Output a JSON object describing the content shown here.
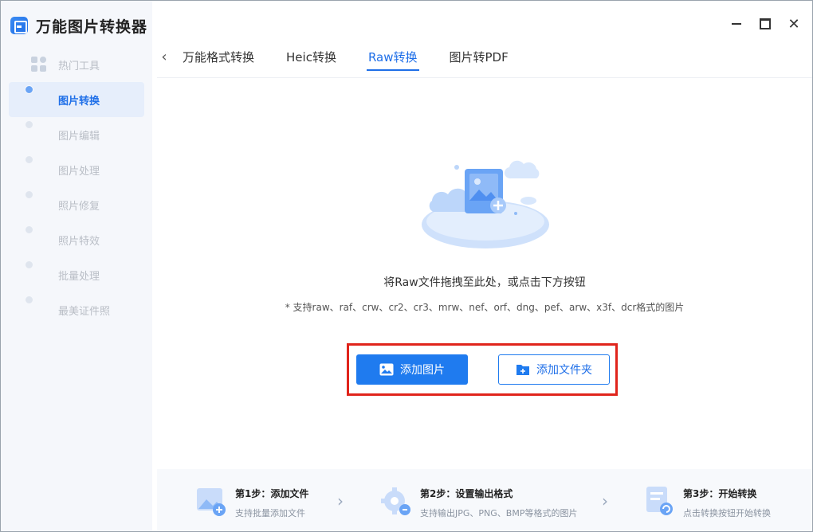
{
  "app": {
    "title": "万能图片转换器"
  },
  "window_controls": {
    "close": "✕"
  },
  "sidebar": {
    "items": [
      {
        "label": "热门工具",
        "icon": "grid-icon",
        "active": false
      },
      {
        "label": "图片转换",
        "icon": "image-convert-icon",
        "active": true
      },
      {
        "label": "图片编辑",
        "icon": "image-edit-icon",
        "active": false
      },
      {
        "label": "图片处理",
        "icon": "image-process-icon",
        "active": false
      },
      {
        "label": "照片修复",
        "icon": "photo-repair-icon",
        "active": false
      },
      {
        "label": "照片特效",
        "icon": "photo-effect-icon",
        "active": false
      },
      {
        "label": "批量处理",
        "icon": "batch-icon",
        "active": false
      },
      {
        "label": "最美证件照",
        "icon": "id-photo-icon",
        "active": false
      }
    ]
  },
  "tabs": {
    "back": "‹",
    "items": [
      {
        "label": "万能格式转换",
        "active": false
      },
      {
        "label": "Heic转换",
        "active": false
      },
      {
        "label": "Raw转换",
        "active": true
      },
      {
        "label": "图片转PDF",
        "active": false
      }
    ]
  },
  "drop": {
    "title": "将Raw文件拖拽至此处，或点击下方按钮",
    "hint": "* 支持raw、raf、crw、cr2、cr3、mrw、nef、orf、dng、pef、arw、x3f、dcr格式的图片",
    "add_image": "添加图片",
    "add_folder": "添加文件夹"
  },
  "steps": [
    {
      "title": "第1步：添加文件",
      "desc": "支持批量添加文件"
    },
    {
      "title": "第2步：设置输出格式",
      "desc": "支持输出JPG、PNG、BMP等格式的图片"
    },
    {
      "title": "第3步：开始转换",
      "desc": "点击转换按钮开始转换"
    }
  ],
  "step_arrow": "›",
  "colors": {
    "accent": "#1f7bef",
    "highlight": "#e0241b"
  }
}
